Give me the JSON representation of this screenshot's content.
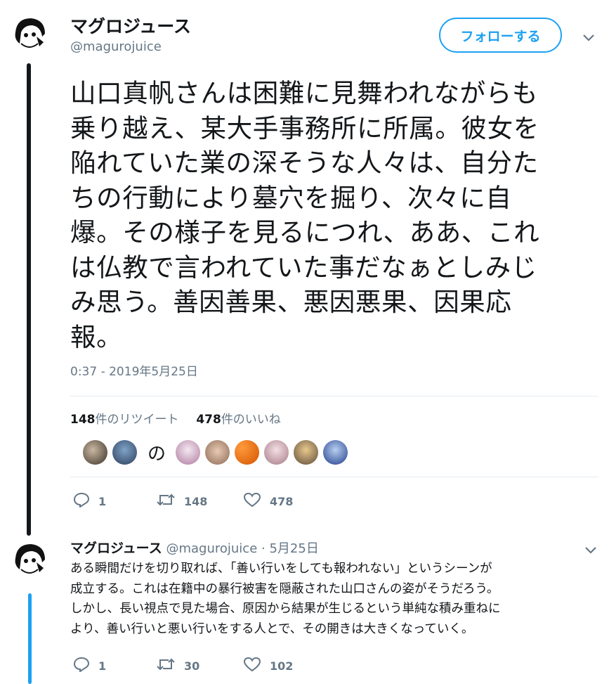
{
  "tweet": {
    "author_name": "マグロジュース",
    "author_handle": "@magurojuice",
    "follow_label": "フォローする",
    "text_lines": [
      "山口真帆さんは困難に見舞われながらも",
      "乗り越え、某大手事務所に所属。彼女を",
      "陥れていた業の深そうな人々は、自分た",
      "ちの行動により墓穴を掘り、次々に自",
      "爆。その様子を見るにつれ、ああ、これ",
      "は仏教で言われていた事だなぁとしみじ",
      "み思う。善因善果、悪因悪果、因果応",
      "報。"
    ],
    "timestamp": "0:37 - 2019年5月25日",
    "retweet_count": "148",
    "retweet_label": "件のリツイート",
    "like_count": "478",
    "like_label": "件のいいね",
    "liker_separator": "の",
    "actions": {
      "reply": "1",
      "retweet": "148",
      "like": "478"
    }
  },
  "reply": {
    "author_name": "マグロジュース",
    "author_handle": "@magurojuice",
    "separator": "·",
    "date": "5月25日",
    "text_lines": [
      "ある瞬間だけを切り取れば、「善い行いをしても報われない」というシーンが",
      "成立する。これは在籍中の暴行被害を隠蔽された山口さんの姿がそうだろう。",
      "しかし、長い視点で見た場合、原因から結果が生じるという単純な積み重ねに",
      "より、善い行いと悪い行いをする人とで、その開きは大きくなっていく。"
    ],
    "actions": {
      "reply": "1",
      "retweet": "30",
      "like": "102"
    }
  },
  "icons": {
    "reply": "reply-icon",
    "retweet": "retweet-icon",
    "like": "heart-icon",
    "more": "chevron-down-icon"
  },
  "colors": {
    "accent": "#1da1f2",
    "thread_line_dark": "#14171a",
    "thread_line_blue": "#1da1f2",
    "muted": "#657786"
  }
}
